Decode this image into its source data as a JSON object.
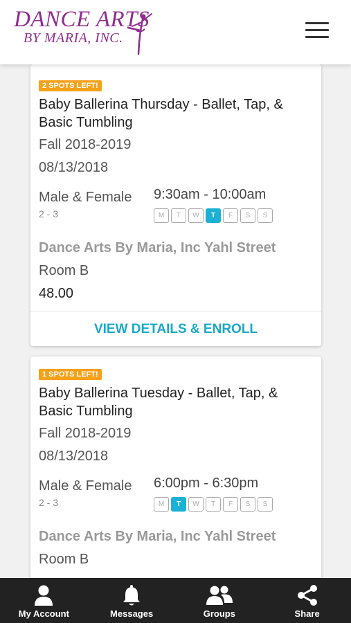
{
  "header": {
    "logo_line1": "DANCE ARTS",
    "logo_line2": "BY MARIA, INC.",
    "brand_color": "#8e2d8f"
  },
  "classes": [
    {
      "badge": "2 SPOTS LEFT!",
      "title": "Baby Ballerina Thursday - Ballet, Tap, & Basic Tumbling",
      "term": "Fall 2018-2019",
      "date": "08/13/2018",
      "gender": "Male & Female",
      "ages": "2 - 3",
      "time": "9:30am - 10:00am",
      "days": [
        "M",
        "T",
        "W",
        "T",
        "F",
        "S",
        "S"
      ],
      "active_day_index": 3,
      "location": "Dance Arts By Maria, Inc Yahl Street",
      "room": "Room B",
      "price": "48.00",
      "action": "VIEW DETAILS & ENROLL"
    },
    {
      "badge": "1 SPOTS LEFT!",
      "title": "Baby Ballerina Tuesday - Ballet, Tap, & Basic Tumbling",
      "term": "Fall 2018-2019",
      "date": "08/13/2018",
      "gender": "Male & Female",
      "ages": "2 - 3",
      "time": "6:00pm - 6:30pm",
      "days": [
        "M",
        "T",
        "W",
        "T",
        "F",
        "S",
        "S"
      ],
      "active_day_index": 1,
      "location": "Dance Arts By Maria, Inc Yahl Street",
      "room": "Room B"
    }
  ],
  "bottom_nav": [
    {
      "label": "My Account",
      "icon": "user-icon"
    },
    {
      "label": "Messages",
      "icon": "bell-icon"
    },
    {
      "label": "Groups",
      "icon": "group-icon"
    },
    {
      "label": "Share",
      "icon": "share-icon"
    }
  ],
  "colors": {
    "badge": "#f5a11a",
    "accent": "#1ab1d4",
    "nav_background": "#222222"
  }
}
